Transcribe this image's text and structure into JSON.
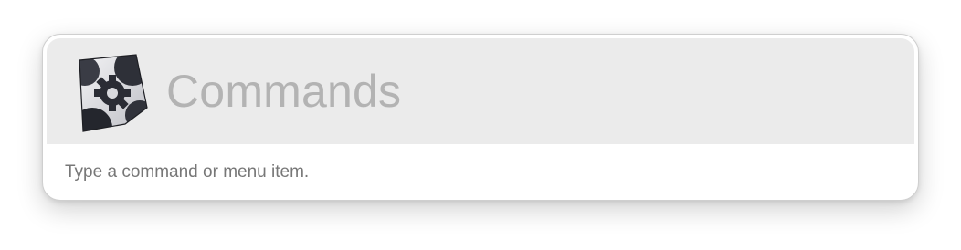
{
  "palette": {
    "icon": "gears-app-icon",
    "query_placeholder": "Commands",
    "hint": "Type a command or menu item."
  },
  "colors": {
    "header_background": "#ebebeb",
    "placeholder_text": "#b3b3b3",
    "hint_text": "#777777",
    "icon_dark": "#2e3038",
    "icon_light": "#e6e6e8"
  }
}
